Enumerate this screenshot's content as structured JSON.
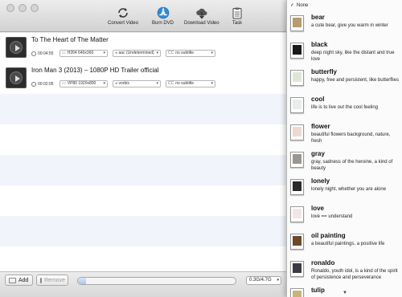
{
  "toolbar": {
    "buttons": [
      {
        "label": "Convert Video",
        "icon": "convert-icon"
      },
      {
        "label": "Burn DVD",
        "icon": "burn-dvd-icon"
      },
      {
        "label": "Download Video",
        "icon": "cloud-download-icon"
      },
      {
        "label": "Task",
        "icon": "clipboard-icon"
      }
    ]
  },
  "videos": [
    {
      "title": "To The Heart of The Matter",
      "duration": "00:04:55",
      "video_codec": "H264 640x360",
      "audio": "aac (Undetermined)",
      "subtitle": "no subtitle"
    },
    {
      "title": "Iron Man 3 (2013) – 1080P HD Trailer official",
      "duration": "00:02:05",
      "video_codec": "VP80 1920x800",
      "audio": "vorbis",
      "subtitle": "no subtitle"
    }
  ],
  "bottom": {
    "add_label": "Add",
    "remove_label": "Remove",
    "capacity": "0.3G/4.7G",
    "progress_fraction": 0.05
  },
  "theme_menu": {
    "none_label": "None",
    "checkmark": "✓",
    "items": [
      {
        "name": "bear",
        "desc": "a cute bear, give you warm in winter",
        "swatch": "#b89c6e"
      },
      {
        "name": "black",
        "desc": "deep night sky, like the distant and true love",
        "swatch": "#1a1a1a"
      },
      {
        "name": "butterfly",
        "desc": "happy, free and persistent, like butterflies",
        "swatch": "#dfe6d8"
      },
      {
        "name": "cool",
        "desc": "life is to live out the cool feeling",
        "swatch": "#e9ede9"
      },
      {
        "name": "flower",
        "desc": "beautiful flowers background, nature, fresh",
        "swatch": "#eed8cf"
      },
      {
        "name": "gray",
        "desc": "gray,  sadness of the heroine,  a kind of beauty",
        "swatch": "#9a9690"
      },
      {
        "name": "lonely",
        "desc": "lonely night, whether you are alone",
        "swatch": "#2a2a2a"
      },
      {
        "name": "love",
        "desc": "love == understand",
        "swatch": "#f1e6e6"
      },
      {
        "name": "oil painting",
        "desc": "a beautiful paintings, a positive life",
        "swatch": "#6b4a2a"
      },
      {
        "name": "ronaldo",
        "desc": "Ronaldo, youth idol, is a kind of the spirit of persistence and perseverance",
        "swatch": "#3b3b44"
      },
      {
        "name": "tulip",
        "desc": "",
        "swatch": "#c9b37a"
      }
    ],
    "scroll_arrow": "▼"
  }
}
